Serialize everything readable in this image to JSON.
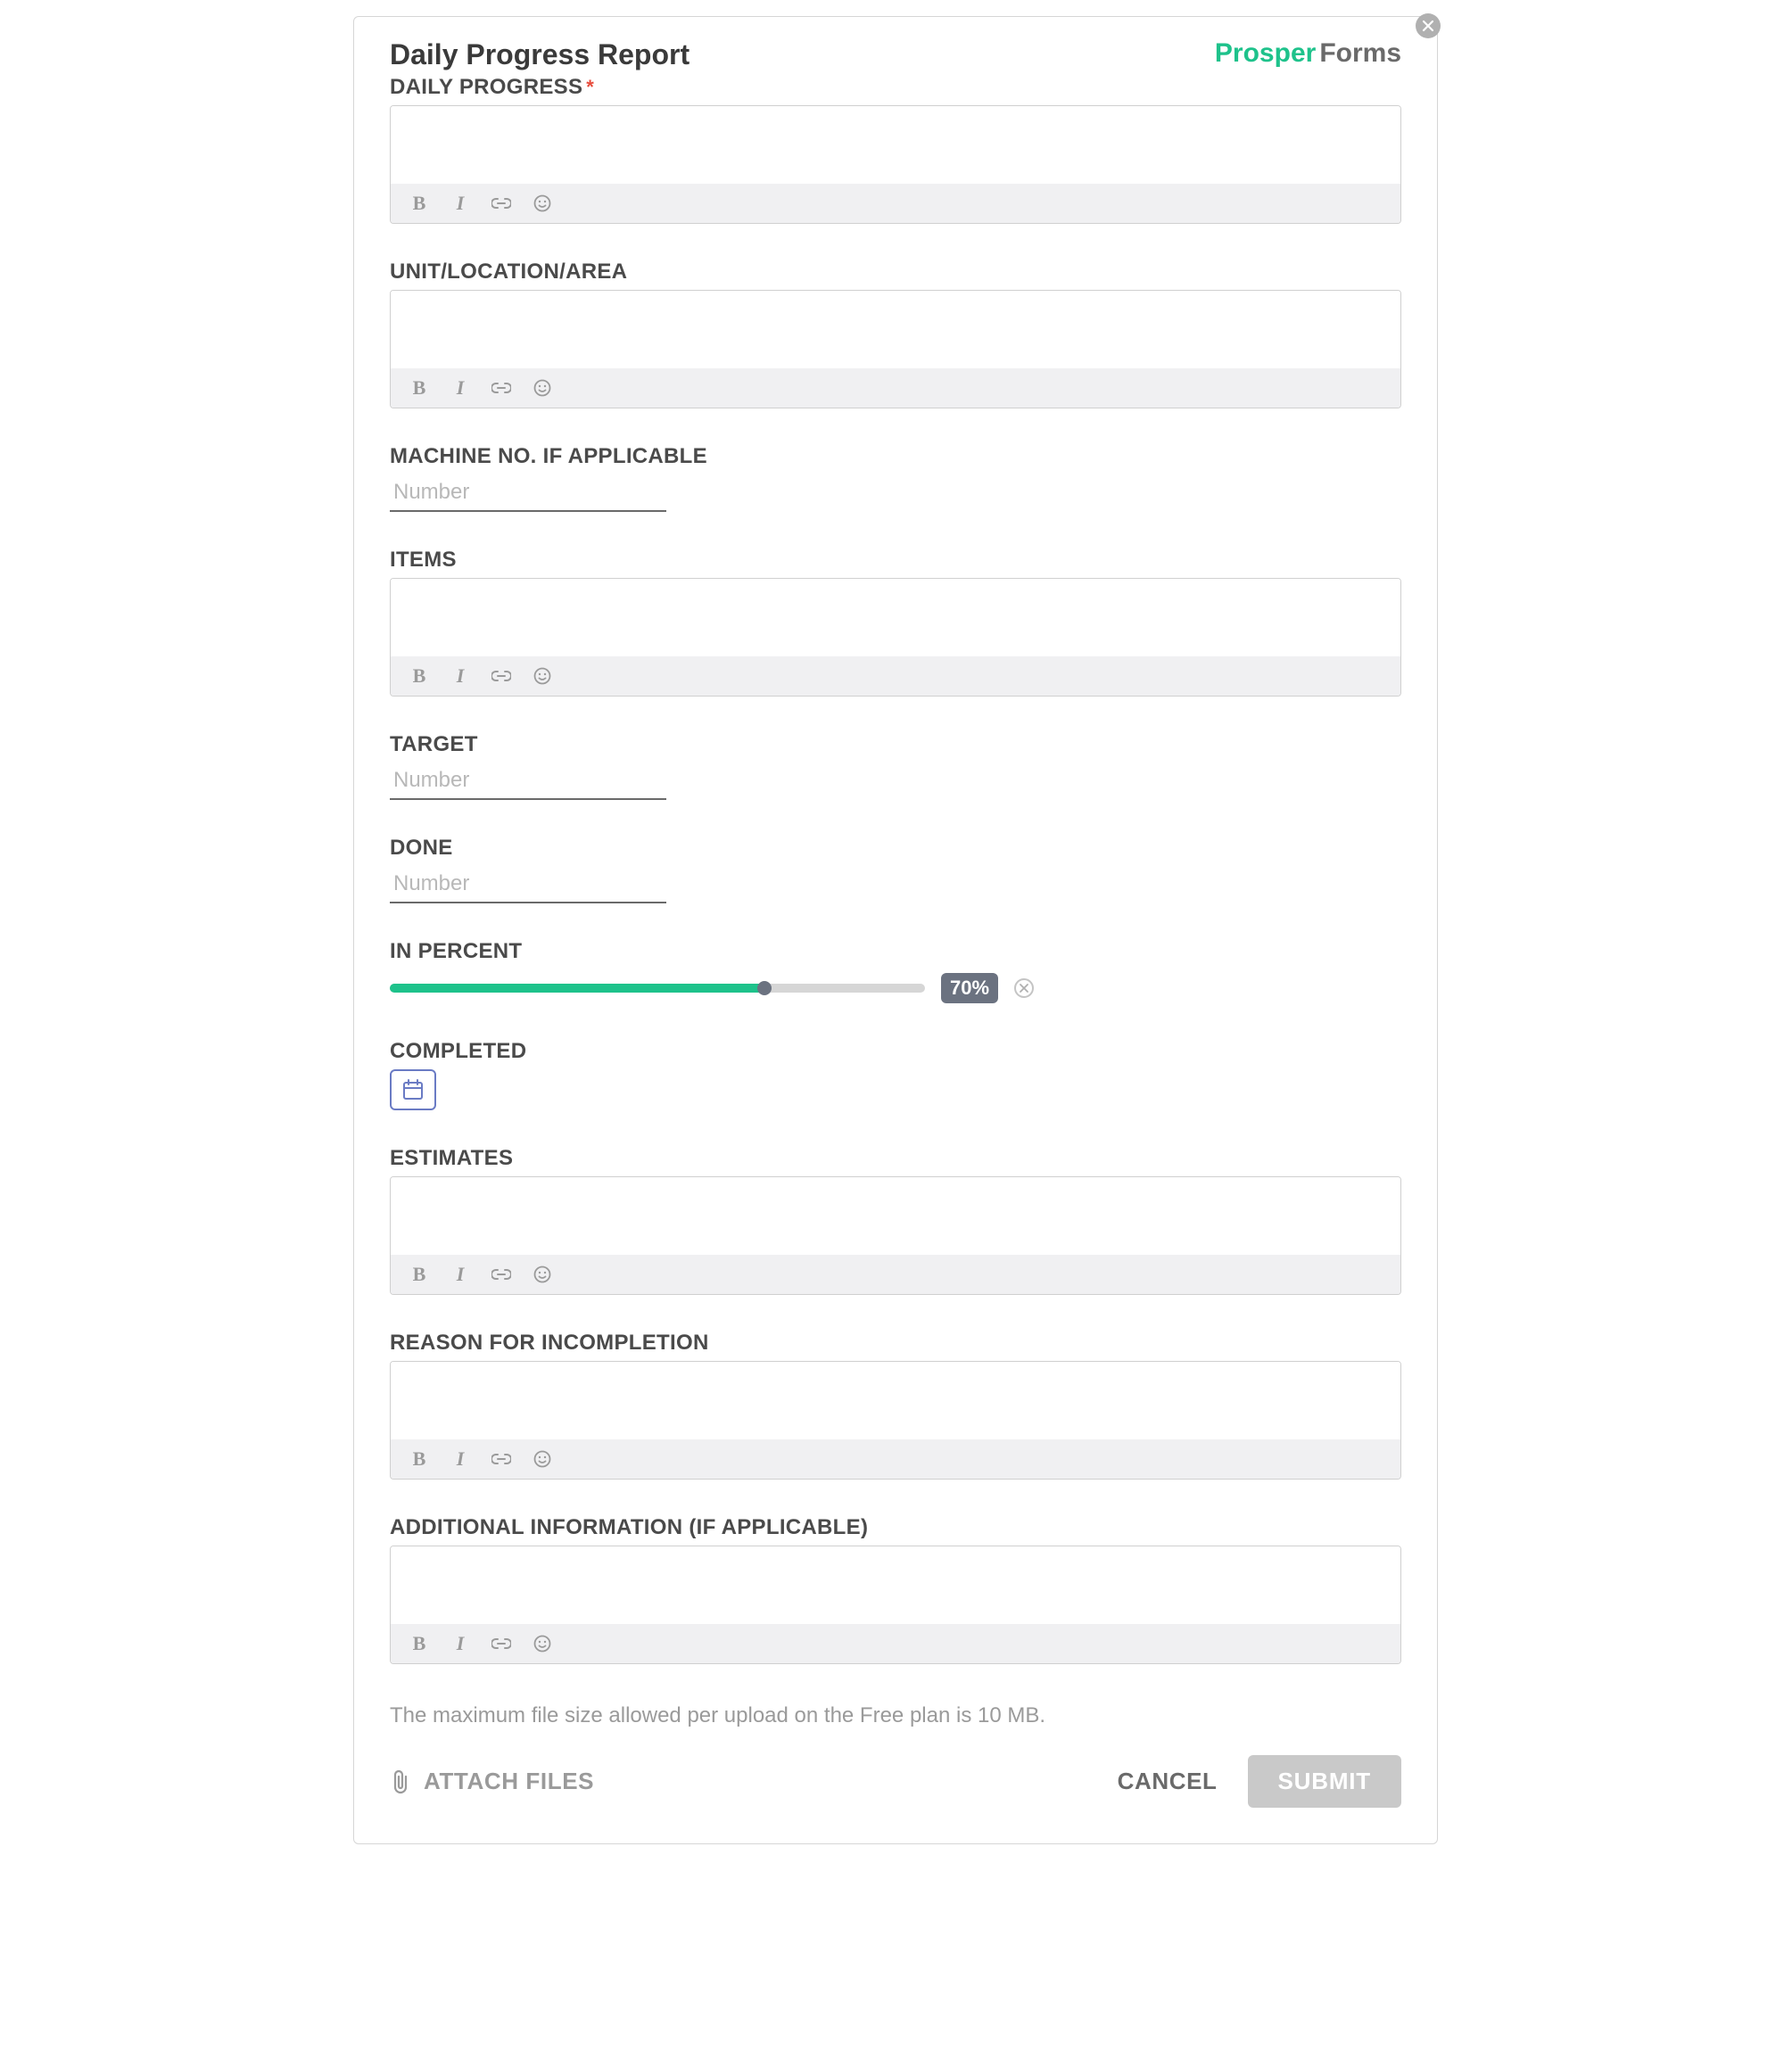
{
  "title": "Daily Progress Report",
  "logo": {
    "part1": "Prosper",
    "part2": "Forms"
  },
  "fields": {
    "daily_progress": {
      "label": "DAILY PROGRESS",
      "required": true
    },
    "unit": {
      "label": "UNIT/LOCATION/AREA"
    },
    "machine": {
      "label": "MACHINE NO. IF APPLICABLE",
      "placeholder": "Number"
    },
    "items": {
      "label": "ITEMS"
    },
    "target": {
      "label": "TARGET",
      "placeholder": "Number"
    },
    "done": {
      "label": "DONE",
      "placeholder": "Number"
    },
    "percent": {
      "label": "IN PERCENT",
      "value": 70,
      "badge": "70%"
    },
    "completed": {
      "label": "COMPLETED"
    },
    "estimates": {
      "label": "ESTIMATES"
    },
    "reason": {
      "label": "REASON FOR INCOMPLETION"
    },
    "additional": {
      "label": "ADDITIONAL INFORMATION (IF APPLICABLE)"
    }
  },
  "toolbar": {
    "bold": "B",
    "italic": "I"
  },
  "file_note": "The maximum file size allowed per upload on the Free plan is 10 MB.",
  "footer": {
    "attach": "ATTACH FILES",
    "cancel": "CANCEL",
    "submit": "SUBMIT"
  }
}
